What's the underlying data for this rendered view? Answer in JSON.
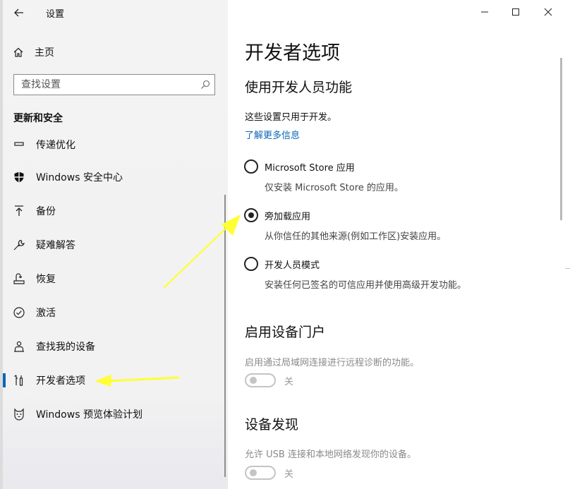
{
  "window": {
    "title": "设置",
    "controls": {
      "minimize": "minimize-icon",
      "maximize": "maximize-icon",
      "close": "close-icon"
    }
  },
  "sidebar": {
    "home_label": "主页",
    "search_placeholder": "查找设置",
    "section_title": "更新和安全",
    "items": [
      {
        "label": "传递优化",
        "icon": "delivery-optimization-icon"
      },
      {
        "label": "Windows 安全中心",
        "icon": "shield-icon"
      },
      {
        "label": "备份",
        "icon": "backup-icon"
      },
      {
        "label": "疑难解答",
        "icon": "wrench-icon"
      },
      {
        "label": "恢复",
        "icon": "recovery-icon"
      },
      {
        "label": "激活",
        "icon": "checkmark-circle-icon"
      },
      {
        "label": "查找我的设备",
        "icon": "person-location-icon"
      },
      {
        "label": "开发者选项",
        "icon": "developer-tools-icon",
        "active": true
      },
      {
        "label": "Windows 预览体验计划",
        "icon": "insider-cat-icon"
      }
    ]
  },
  "main": {
    "page_title": "开发者选项",
    "dev_features": {
      "heading": "使用开发人员功能",
      "note": "这些设置只用于开发。",
      "link": "了解更多信息",
      "options": [
        {
          "label": "Microsoft Store 应用",
          "description": "仅安装 Microsoft Store 的应用。",
          "selected": false
        },
        {
          "label": "旁加载应用",
          "description": "从你信任的其他来源(例如工作区)安装应用。",
          "selected": true
        },
        {
          "label": "开发人员模式",
          "description": "安装任何已签名的可信应用并使用高级开发功能。",
          "selected": false
        }
      ]
    },
    "device_portal": {
      "heading": "启用设备门户",
      "description": "启用通过局域网连接进行远程诊断的功能。",
      "toggle_label": "关",
      "toggle_on": false
    },
    "device_discovery": {
      "heading": "设备发现",
      "description": "允许 USB 连接和本地网络发现你的设备。",
      "toggle_label": "关",
      "toggle_on": false
    }
  },
  "colors": {
    "accent": "#0a66b8",
    "annotation_arrow": "#ffff33"
  }
}
